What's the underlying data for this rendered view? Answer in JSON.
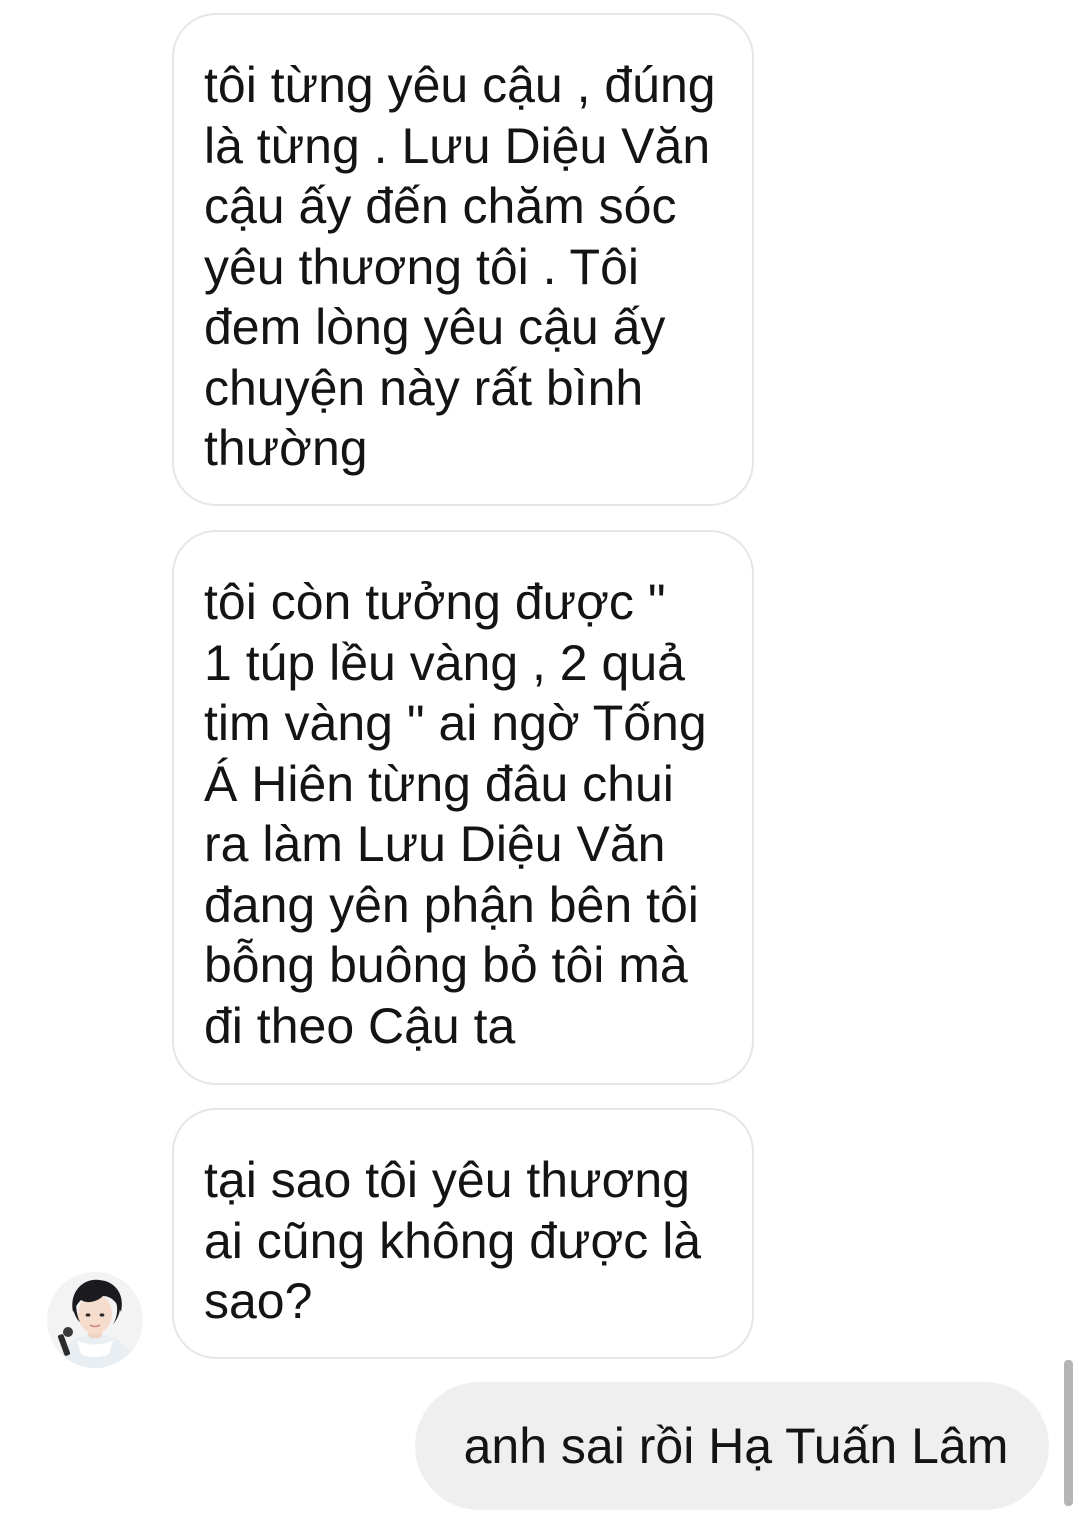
{
  "messages": {
    "incoming": [
      {
        "text": "tôi từng yêu cậu , đúng\nlà từng . Lưu Diệu Văn\ncậu ấy đến chăm sóc\nyêu thương tôi . Tôi\nđem lòng yêu cậu ấy\nchuyện này rất bình\nthường"
      },
      {
        "text": "tôi còn tưởng được \"\n1 túp lều vàng , 2 quả\ntim vàng \" ai ngờ Tống\nÁ Hiên từng đâu chui\nra làm Lưu Diệu Văn\nđang yên phận bên tôi\nbỗng buông bỏ tôi mà\nđi theo Cậu ta"
      },
      {
        "text": "tại sao tôi yêu thương\nai cũng không được là\nsao?"
      }
    ],
    "outgoing": [
      {
        "text": "anh sai rồi Hạ Tuấn Lâm"
      }
    ]
  },
  "colors": {
    "incoming_bubble_border": "#e6e6e6",
    "outgoing_bubble_bg": "#efefef",
    "text": "#141414"
  },
  "icons": {
    "sender_avatar": "avatar"
  }
}
